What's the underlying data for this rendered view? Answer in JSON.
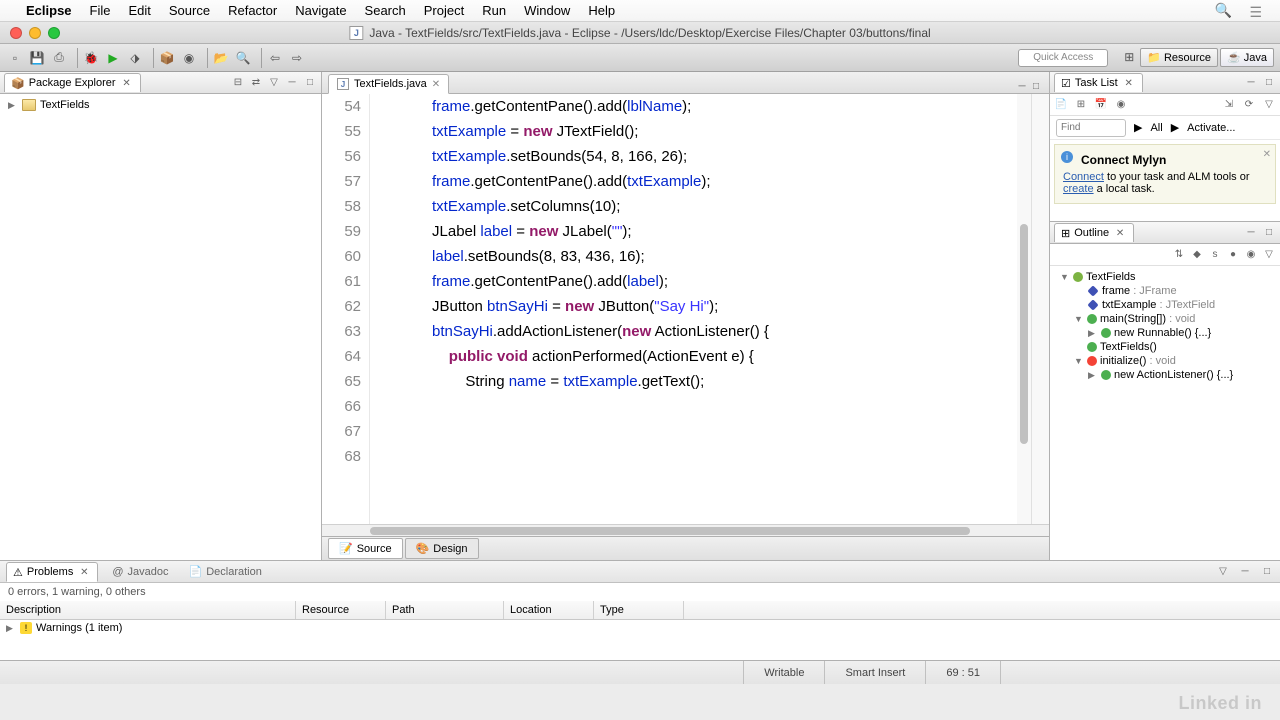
{
  "menubar": {
    "items": [
      "Eclipse",
      "File",
      "Edit",
      "Source",
      "Refactor",
      "Navigate",
      "Search",
      "Project",
      "Run",
      "Window",
      "Help"
    ]
  },
  "titlebar": {
    "title": "Java - TextFields/src/TextFields.java - Eclipse - /Users/ldc/Desktop/Exercise Files/Chapter 03/buttons/final"
  },
  "toolbar": {
    "quick_access": "Quick Access",
    "perspectives": [
      {
        "label": "Resource"
      },
      {
        "label": "Java"
      }
    ]
  },
  "package_explorer": {
    "title": "Package Explorer",
    "project": "TextFields"
  },
  "editor": {
    "tab": "TextFields.java",
    "first_line": 54,
    "lines": [
      "            frame.getContentPane().add(lblName);",
      "",
      "            txtExample = new JTextField();",
      "            txtExample.setBounds(54, 8, 166, 26);",
      "            frame.getContentPane().add(txtExample);",
      "            txtExample.setColumns(10);",
      "",
      "            JLabel label = new JLabel(\"\");",
      "            label.setBounds(8, 83, 436, 16);",
      "            frame.getContentPane().add(label);",
      "",
      "            JButton btnSayHi = new JButton(\"Say Hi\");",
      "            btnSayHi.addActionListener(new ActionListener() {",
      "                public void actionPerformed(ActionEvent e) {",
      "                    String name = txtExample.getText();"
    ],
    "bottom_tabs": {
      "source": "Source",
      "design": "Design"
    }
  },
  "task_list": {
    "title": "Task List",
    "find_placeholder": "Find",
    "all": "All",
    "activate": "Activate...",
    "mylyn_title": "Connect Mylyn",
    "mylyn_text1": "Connect",
    "mylyn_text2": " to your task and ALM tools or ",
    "mylyn_text3": "create",
    "mylyn_text4": " a local task."
  },
  "outline": {
    "title": "Outline",
    "items": [
      {
        "level": 0,
        "kind": "class",
        "name": "TextFields",
        "arrow": "▼"
      },
      {
        "level": 1,
        "kind": "field",
        "name": "frame",
        "type": "JFrame"
      },
      {
        "level": 1,
        "kind": "field",
        "name": "txtExample",
        "type": "JTextField"
      },
      {
        "level": 1,
        "kind": "method",
        "name": "main(String[])",
        "type": "void",
        "arrow": "▼",
        "static": true
      },
      {
        "level": 2,
        "kind": "method",
        "name": "new Runnable() {...}",
        "arrow": "▶"
      },
      {
        "level": 1,
        "kind": "ctor",
        "name": "TextFields()"
      },
      {
        "level": 1,
        "kind": "private",
        "name": "initialize()",
        "type": "void",
        "arrow": "▼"
      },
      {
        "level": 2,
        "kind": "method",
        "name": "new ActionListener() {...}",
        "arrow": "▶"
      }
    ]
  },
  "problems": {
    "tabs": {
      "problems": "Problems",
      "javadoc": "Javadoc",
      "declaration": "Declaration"
    },
    "summary": "0 errors, 1 warning, 0 others",
    "columns": [
      "Description",
      "Resource",
      "Path",
      "Location",
      "Type"
    ],
    "warning_row": "Warnings (1 item)"
  },
  "statusbar": {
    "writable": "Writable",
    "insert": "Smart Insert",
    "pos": "69 : 51"
  },
  "watermark": "Linked in"
}
